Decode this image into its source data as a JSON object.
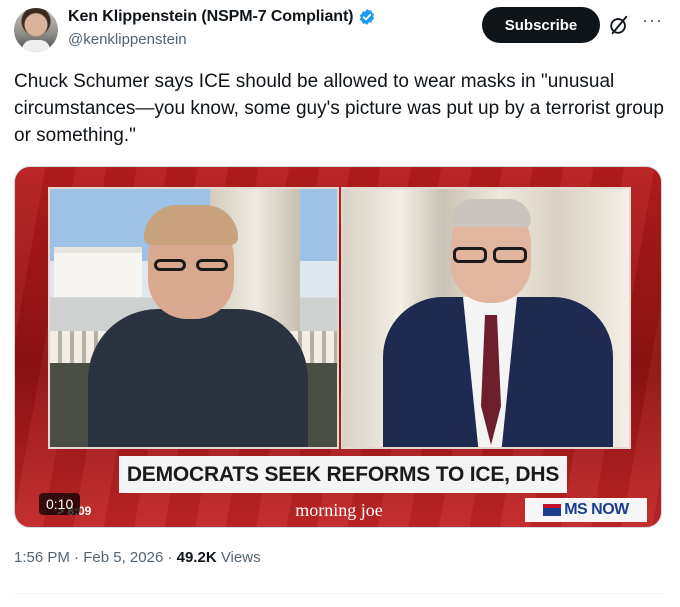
{
  "author": {
    "name": "Ken Klippenstein (NSPM-7 Compliant)",
    "handle": "@kenklippenstein",
    "verified_color": "#1d9bf0"
  },
  "actions": {
    "subscribe_label": "Subscribe",
    "grok_icon": "grok-icon",
    "more_icon": "more-icon"
  },
  "tweet": {
    "text": "Chuck Schumer says ICE should be allowed to wear masks in \"unusual circumstances—you know, some guy's picture was put up by a terrorist group or something.\""
  },
  "video": {
    "chyron": "DEMOCRATS SEEK REFORMS TO ICE, DHS",
    "show_name": "morning joe",
    "network": "MS NOW",
    "live_time": "> 8:09",
    "duration": "0:10",
    "accent_color": "#b71d1d"
  },
  "footer": {
    "time": "1:56 PM",
    "date": "Feb 5, 2026",
    "views_count": "49.2K",
    "views_label": "Views"
  }
}
